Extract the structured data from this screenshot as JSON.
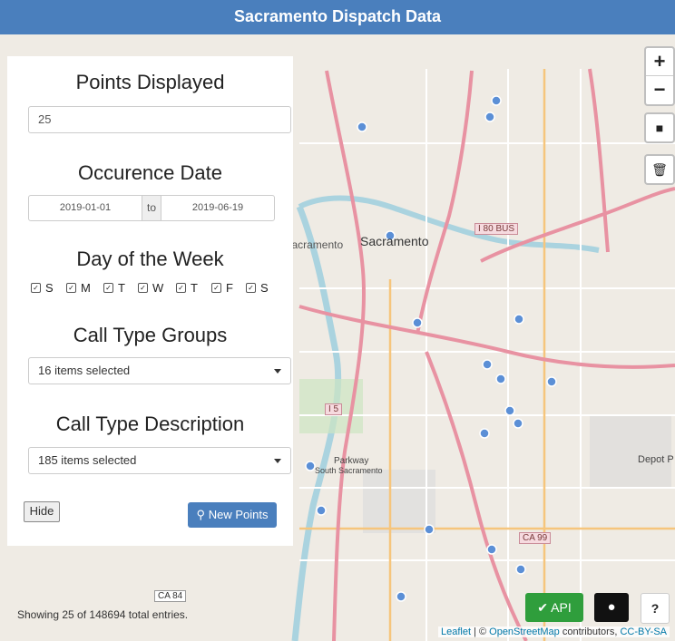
{
  "header": {
    "title": "Sacramento Dispatch Data"
  },
  "panel": {
    "points_title": "Points Displayed",
    "points_value": "25",
    "date_title": "Occurence Date",
    "date_from": "2019-01-01",
    "date_to_label": "to",
    "date_to": "2019-06-19",
    "dow_title": "Day of the Week",
    "days": [
      "S",
      "M",
      "T",
      "W",
      "T",
      "F",
      "S"
    ],
    "call_groups_title": "Call Type Groups",
    "call_groups_value": "16 items selected",
    "call_desc_title": "Call Type Description",
    "call_desc_value": "185 items selected",
    "hide_label": "Hide",
    "new_points_label": "New Points"
  },
  "map_controls": {
    "zoom_in": "+",
    "zoom_out": "−"
  },
  "map_labels": {
    "sacramento": "Sacramento",
    "west_sacramento": "West Sacramento",
    "i80bus": "I 80 BUS",
    "i5": "I 5",
    "ca99": "CA 99",
    "ca84": "CA 84",
    "parkway": "Parkway",
    "south_sac": "South Sacramento",
    "depot": "Depot P"
  },
  "footer": {
    "showing": "Showing 25 of 148694 total entries.",
    "api_label": "API",
    "help_label": "?",
    "attrib_leaflet": "Leaflet",
    "attrib_sep": " | © ",
    "attrib_osm": "OpenStreetMap",
    "attrib_contrib": " contributors, ",
    "attrib_license": "CC-BY-SA"
  },
  "colors": {
    "header": "#4a7fbd",
    "api": "#2f9e3c",
    "marker": "#5b8fd6"
  }
}
